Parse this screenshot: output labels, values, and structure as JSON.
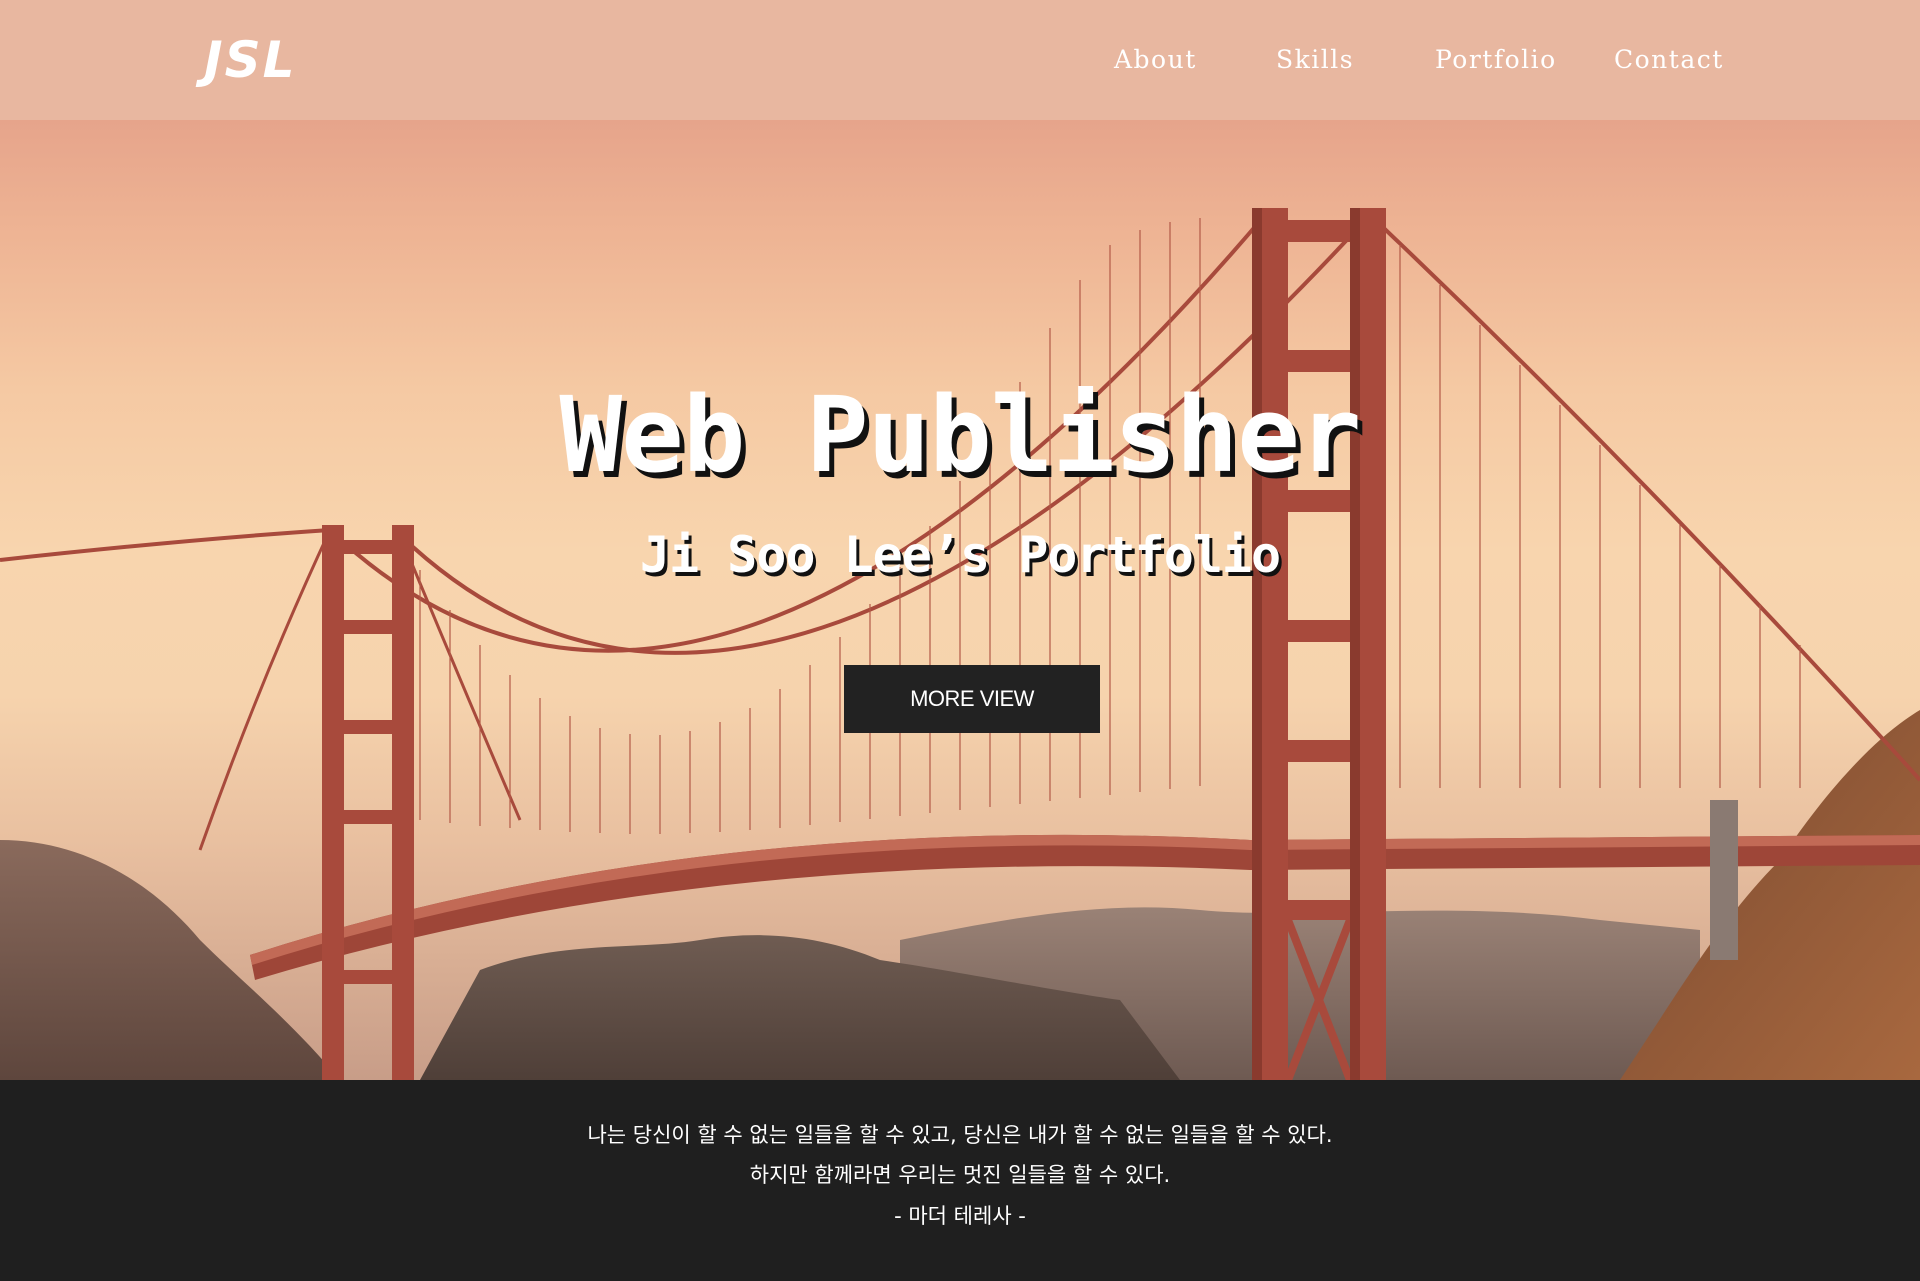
{
  "header": {
    "logo": "JSL",
    "nav": {
      "about": "About",
      "skills": "Skills",
      "portfolio": "Portfolio",
      "contact": "Contact"
    }
  },
  "hero": {
    "title": "Web Publisher",
    "subtitle": "Ji Soo Lee’s Portfolio",
    "button_label": "MORE VIEW",
    "background_image": "golden-gate-bridge-sunset"
  },
  "quote": {
    "line1": "나는 당신이 할 수 없는 일들을 할 수 있고, 당신은 내가 할 수 없는 일들을 할 수 있다.",
    "line2": "하지만 함께라면 우리는 멋진 일들을 할 수 있다.",
    "author": "- 마더 테레사 -"
  },
  "colors": {
    "header_bg": "#e8b7a0",
    "bridge": "#a84a3c",
    "button_bg": "#222222",
    "footer_bg": "#1f1f1f"
  }
}
